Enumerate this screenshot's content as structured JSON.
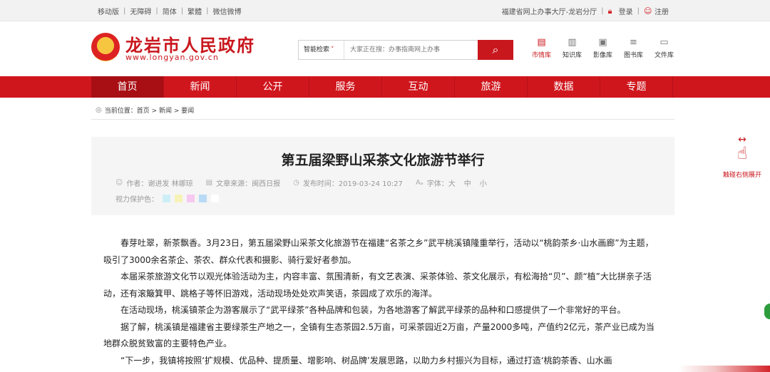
{
  "topbar": {
    "left_links": [
      "移动版",
      "无障碍",
      "简体",
      "繁體",
      "微信微博"
    ],
    "hall": "福建省网上办事大厅-龙岩分厅",
    "login": "登录",
    "register": "注册"
  },
  "header": {
    "site_title": "龙岩市人民政府",
    "site_url": "www.longyan.gov.cn",
    "search_type": "智能检索",
    "search_placeholder": "大家正在搜：办事指南网上办事",
    "libraries": [
      {
        "label": "市情库",
        "icon": "city-icon"
      },
      {
        "label": "知识库",
        "icon": "book-icon"
      },
      {
        "label": "影像库",
        "icon": "image-icon"
      },
      {
        "label": "图书库",
        "icon": "library-icon"
      },
      {
        "label": "文件库",
        "icon": "folder-icon"
      }
    ]
  },
  "nav": {
    "items": [
      "首页",
      "新闻",
      "公开",
      "服务",
      "互动",
      "旅游",
      "数据",
      "专题"
    ],
    "active": 0
  },
  "breadcrumb": {
    "label": "当前位置：",
    "path": "首页 > 新闻 > 要闻"
  },
  "article": {
    "title": "第五届梁野山采茶文化旅游节举行",
    "author": "作者：谢进发 林娜琼",
    "source": "文章来源：闽西日报",
    "time": "发布时间：2019-03-24 10:27",
    "font_label": "字体：",
    "font_sizes": [
      "大",
      "中",
      "小"
    ],
    "eye_label": "视力保护色：",
    "eye_colors": [
      "#cdeef7",
      "#f6f3b8",
      "#f5c9f0",
      "#b8daf6",
      "#ffffff"
    ],
    "paragraphs": [
      "春芽吐翠，新茶飘香。3月23日，第五届梁野山采茶文化旅游节在福建“名茶之乡”武平桃溪镇隆重举行，活动以“桃韵茶乡·山水画廊”为主题，吸引了3000余名茶企、茶农、群众代表和摄影、骑行爱好者参加。",
      "本届采茶旅游文化节以观光体验活动为主，内容丰富、氛围清新，有文艺表演、采茶体验、茶文化展示，有松海拾“贝”、颜“植”大比拼亲子活动，还有滚簸箕甲、跳格子等怀旧游戏，活动现场处处欢声笑语，茶园成了欢乐的海洋。",
      "在活动现场，桃溪镇茶企为游客展示了“武平绿茶”各种品牌和包装，为各地游客了解武平绿茶的品种和口感提供了一个非常好的平台。",
      "据了解，桃溪镇是福建省主要绿茶生产地之一，全镇有生态茶园2.5万亩，可采茶园近2万亩，产量2000多吨，产值约2亿元，茶产业已成为当地群众脱贫致富的主要特色产业。",
      "“下一步，我镇将按照‘扩规模、优品种、提质量、增影响、树品牌’发展思路，以助力乡村振兴为目标，通过打造‘桃韵茶香、山水画"
    ]
  },
  "side": {
    "expand_label": "触碰右侧展开"
  }
}
